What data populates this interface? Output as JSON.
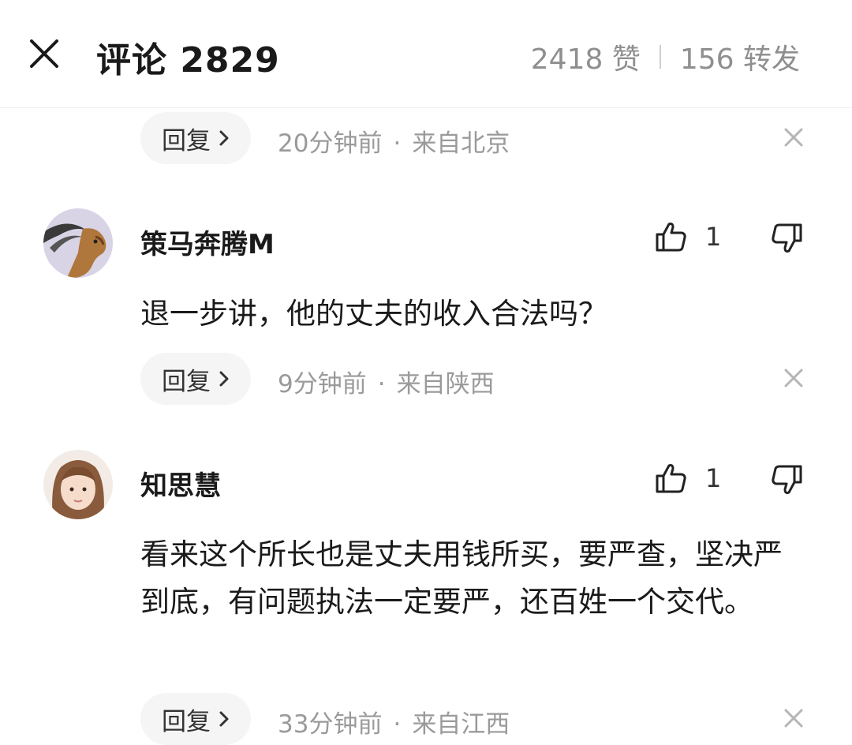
{
  "header": {
    "title": "评论 2829",
    "likes": "2418 赞",
    "reposts": "156 转发"
  },
  "top_reply_row": {
    "reply_label": "回复",
    "time": "20分钟前",
    "location": "来自北京"
  },
  "comments": [
    {
      "username": "策马奔腾M",
      "like_count": "1",
      "text": "退一步讲，他的丈夫的收入合法吗？",
      "reply_label": "回复",
      "time": "9分钟前",
      "location": "来自陕西"
    },
    {
      "username": "知思慧",
      "like_count": "1",
      "text": "看来这个所长也是丈夫用钱所买，要严查，坚决严到底，有问题执法一定要严，还百姓一个交代。",
      "reply_label": "回复",
      "time": "33分钟前",
      "location": "来自江西"
    }
  ],
  "icons": {
    "close": "close-icon",
    "like": "thumbs-up-icon",
    "dislike": "thumbs-down-icon",
    "dismiss": "dismiss-x-icon",
    "chevron": "chevron-right-icon"
  },
  "colors": {
    "text": "#1a1a1a",
    "secondary": "#9a9a9a",
    "pill": "#f5f5f5"
  }
}
